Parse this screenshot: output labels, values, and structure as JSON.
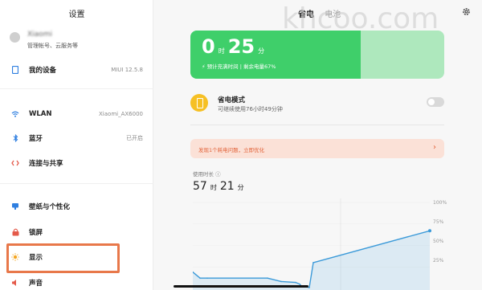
{
  "sidebar": {
    "title": "设置",
    "account": {
      "name": "Xiaomi",
      "subtitle": "管理帐号、云服务等"
    },
    "items": [
      {
        "label": "我的设备",
        "value": "MIUI 12.5.8",
        "icon": "tablet-icon"
      },
      {
        "label": "WLAN",
        "value": "Xiaomi_AX6000",
        "icon": "wifi-icon"
      },
      {
        "label": "蓝牙",
        "value": "已开启",
        "icon": "bluetooth-icon"
      },
      {
        "label": "连接与共享",
        "value": "",
        "icon": "share-icon"
      },
      {
        "label": "壁纸与个性化",
        "value": "",
        "icon": "wallpaper-icon"
      },
      {
        "label": "锁屏",
        "value": "",
        "icon": "lock-icon"
      },
      {
        "label": "显示",
        "value": "",
        "icon": "brightness-icon"
      },
      {
        "label": "声音",
        "value": "",
        "icon": "sound-icon"
      }
    ],
    "highlight_color": "#e8784a"
  },
  "main": {
    "tabs": [
      {
        "label": "省电",
        "active": true
      },
      {
        "label": "电池",
        "active": false
      }
    ],
    "watermark": "khcoo.com",
    "battery": {
      "hours": "0",
      "hours_unit": "时",
      "minutes": "25",
      "minutes_unit": "分",
      "subtitle": "⚡ 预计充满时间 | 剩余电量67%",
      "level": 0.67,
      "fill_color": "#3fcf6a",
      "track_color": "#aee8bd"
    },
    "power_saver": {
      "title": "省电模式",
      "subtitle": "可继续使用76小时49分钟",
      "enabled": false
    },
    "alert": {
      "text": "发现1个耗电问题，立即优化",
      "arrow": "›",
      "color": "#e2643b"
    },
    "usage": {
      "label": "使用时长 ⓘ",
      "hours": "57",
      "hours_unit": "时",
      "minutes": "21",
      "minutes_unit": "分"
    }
  },
  "chart_data": {
    "type": "line",
    "y_ticks": [
      "100%",
      "75%",
      "50%",
      "25%"
    ],
    "ylim": [
      0,
      100
    ],
    "x": [
      0,
      6,
      12,
      48,
      60,
      62,
      70,
      78,
      84,
      88,
      94
    ],
    "values": [
      19,
      12,
      12,
      12,
      8,
      7,
      5,
      3,
      2,
      1,
      30,
      67
    ],
    "line_color": "#3b9ad9"
  }
}
